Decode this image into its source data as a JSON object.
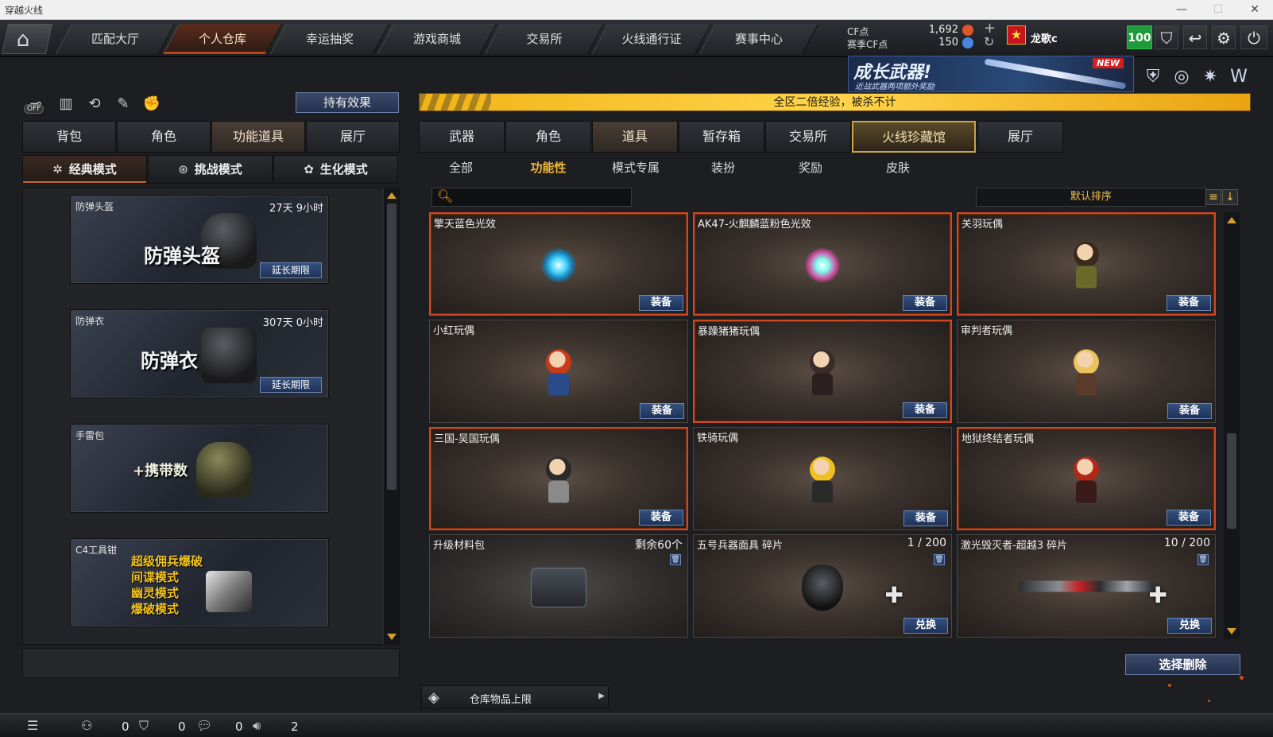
{
  "window": {
    "title": "穿越火线",
    "minimize": "—",
    "maximize": "☐",
    "close": "✕"
  },
  "topnav": {
    "tabs": [
      {
        "label": "匹配大厅",
        "active": false
      },
      {
        "label": "个人仓库",
        "active": true
      },
      {
        "label": "幸运抽奖",
        "active": false
      },
      {
        "label": "游戏商城",
        "active": false
      },
      {
        "label": "交易所",
        "active": false
      },
      {
        "label": "火线通行证",
        "active": false
      },
      {
        "label": "赛事中心",
        "active": false
      }
    ],
    "currency": {
      "cf_label": "CF点",
      "cf_value": "1,692",
      "season_label": "赛季CF点",
      "season_value": "150",
      "add": "+",
      "refresh": "↻"
    },
    "user": {
      "name": "龙歌c",
      "level": "100"
    }
  },
  "banner": {
    "title": "成长武器!",
    "subtitle": "近战武器两项额外奖励",
    "badge": "NEW"
  },
  "promo_text": "全区二倍经验，被杀不计",
  "left": {
    "off_label": "OFF",
    "effect_button": "持有效果",
    "tabs": [
      {
        "label": "背包",
        "active": false
      },
      {
        "label": "角色",
        "active": false
      },
      {
        "label": "功能道具",
        "active": true
      },
      {
        "label": "展厅",
        "active": false
      }
    ],
    "modes": [
      {
        "label": "经典模式",
        "icon": "✲",
        "active": true
      },
      {
        "label": "挑战模式",
        "icon": "⊛",
        "active": false
      },
      {
        "label": "生化模式",
        "icon": "✿",
        "active": false
      }
    ],
    "items": [
      {
        "name": "防弹头盔",
        "time": "27天 9小时",
        "big": "防弹头盔",
        "button": "延长期限"
      },
      {
        "name": "防弹衣",
        "time": "307天 0小时",
        "big": "防弹衣",
        "button": "延长期限"
      },
      {
        "name": "手雷包",
        "time": "",
        "big": "+携带数",
        "button": ""
      },
      {
        "name": "C4工具钳",
        "time": "",
        "lines": [
          "超级佣兵爆破",
          "间谍模式",
          "幽灵模式",
          "爆破模式"
        ],
        "button": ""
      }
    ]
  },
  "right": {
    "tabs": [
      {
        "label": "武器",
        "active": false
      },
      {
        "label": "角色",
        "active": false
      },
      {
        "label": "道具",
        "active": true
      },
      {
        "label": "暂存箱",
        "active": false
      },
      {
        "label": "交易所",
        "active": false
      },
      {
        "label": "火线珍藏馆",
        "active": false,
        "gold": true
      },
      {
        "label": "展厅",
        "active": false
      }
    ],
    "subtabs": [
      {
        "label": "全部",
        "active": false
      },
      {
        "label": "功能性",
        "active": true
      },
      {
        "label": "模式专属",
        "active": false
      },
      {
        "label": "装扮",
        "active": false
      },
      {
        "label": "奖励",
        "active": false
      },
      {
        "label": "皮肤",
        "active": false
      }
    ],
    "search_placeholder": "",
    "sort_label": "默认排序",
    "cards": [
      {
        "name": "擎天蓝色光效",
        "info": "",
        "button": "装备",
        "art": "glow-blue",
        "highlight": true
      },
      {
        "name": "AK47-火麒麟蓝粉色光效",
        "info": "",
        "button": "装备",
        "art": "glow-pink",
        "highlight": true
      },
      {
        "name": "关羽玩偶",
        "info": "",
        "button": "装备",
        "art": "doll-guanyu",
        "highlight": true
      },
      {
        "name": "小红玩偶",
        "info": "",
        "button": "装备",
        "art": "doll-red",
        "highlight": false
      },
      {
        "name": "暴躁猪猪玩偶",
        "info": "",
        "button": "装备",
        "art": "doll-pig",
        "highlight": true
      },
      {
        "name": "审判者玩偶",
        "info": "",
        "button": "装备",
        "art": "doll-judge",
        "highlight": false
      },
      {
        "name": "三国-吴国玩偶",
        "info": "",
        "button": "装备",
        "art": "doll-wu",
        "highlight": true
      },
      {
        "name": "铁骑玩偶",
        "info": "",
        "button": "装备",
        "art": "doll-rider",
        "highlight": false
      },
      {
        "name": "地狱终结者玩偶",
        "info": "",
        "button": "装备",
        "art": "doll-hell",
        "highlight": true
      },
      {
        "name": "升级材料包",
        "info": "剩余60个",
        "button": "",
        "art": "chest",
        "highlight": false,
        "trash": true
      },
      {
        "name": "五号兵器面具 碎片",
        "info": "1 / 200",
        "button": "兑换",
        "art": "mask",
        "highlight": false,
        "trash": true
      },
      {
        "name": "激光毁灭者-超越3 碎片",
        "info": "10 / 200",
        "button": "兑换",
        "art": "gun",
        "highlight": false,
        "trash": true
      }
    ],
    "delete_button": "选择删除",
    "storage_label": "仓库物品上限"
  },
  "bottombar": {
    "values": [
      "0",
      "0",
      "0",
      "2"
    ]
  }
}
